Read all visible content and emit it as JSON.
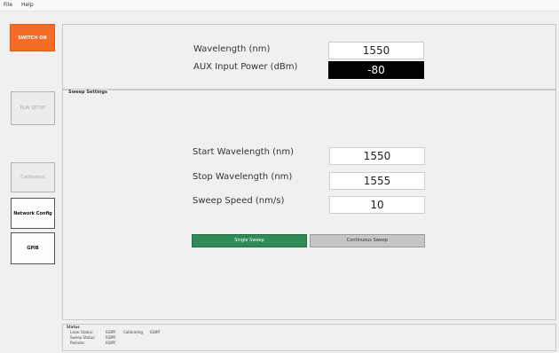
{
  "menu": {
    "file": "File",
    "help": "Help"
  },
  "nav": {
    "switch_on": "SWITCH ON",
    "run_setup": "RUN SETUP",
    "calibration": "Calibration",
    "network_config": "Network Config",
    "gpib": "GPIB"
  },
  "top_panel": {
    "wavelength_label": "Wavelength (nm)",
    "wavelength_value": "1550",
    "aux_label": "AUX Input Power (dBm)",
    "aux_value": "-80"
  },
  "sweep": {
    "title": "Sweep Settings",
    "start_label": "Start Wavelength (nm)",
    "start_value": "1550",
    "stop_label": "Stop Wavelength (nm)",
    "stop_value": "1555",
    "speed_label": "Sweep Speed (nm/s)",
    "speed_value": "10",
    "single_button": "Single Sweep",
    "continuous_button": "Continuous Sweep"
  },
  "status": {
    "title": "Status",
    "laser_label": "Laser Status:",
    "laser_value": "IGBPF",
    "calibrating_label": "Calibrating",
    "calibrating_value": "IGBPF",
    "sweep_label": "Sweep Status:",
    "sweep_value": "IGBPF",
    "remote_label": "Remote:",
    "remote_value": "IGBPF"
  },
  "colors": {
    "switch_on": "#f56d24",
    "single_sweep": "#2f8a55",
    "continuous_sweep": "#c6c6c6"
  }
}
